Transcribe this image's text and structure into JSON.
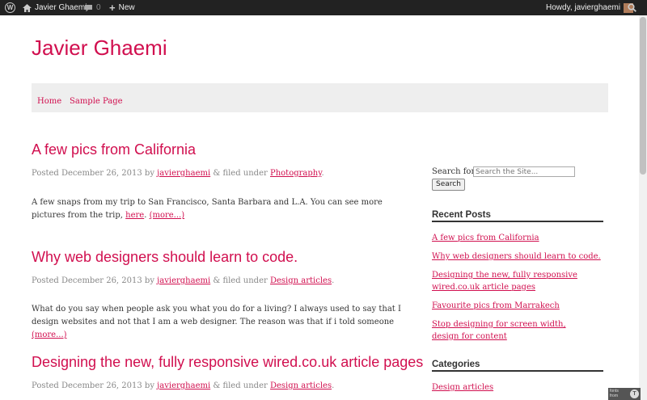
{
  "admin_bar": {
    "site_name": "Javier Ghaemi",
    "comments_count": "0",
    "new_label": "New",
    "greeting": "Howdy, javierghaemi"
  },
  "site": {
    "title": "Javier Ghaemi"
  },
  "nav": {
    "items": [
      "Home",
      "Sample Page"
    ]
  },
  "posts": [
    {
      "title": "A few pics from California",
      "meta_prefix": "Posted December 26, 2013 by",
      "author": "javierghaemi",
      "filed_text": "& filed under",
      "category": "Photography",
      "end": ".",
      "excerpt": "A few snaps from my trip to San Francisco, Santa Barbara and L.A. You can see more pictures from the trip,",
      "link_text": "here",
      "more": "(more...)"
    },
    {
      "title": "Why web designers should learn to code.",
      "meta_prefix": "Posted December 26, 2013 by",
      "author": "javierghaemi",
      "filed_text": "& filed under",
      "category": "Design articles",
      "end": ".",
      "excerpt": "What do you say when people ask you what you do for a living? I always used to say that I design websites and not that I am a web designer. The reason was that if i told someone",
      "more": "(more...)"
    },
    {
      "title": "Designing the new, fully responsive wired.co.uk article pages",
      "meta_prefix": "Posted December 26, 2013 by",
      "author": "javierghaemi",
      "filed_text": "& filed under",
      "category": "Design articles",
      "end": "."
    }
  ],
  "sidebar": {
    "search_label": "Search for:",
    "search_placeholder": "Search the Site...",
    "search_button": "Search",
    "recent_title": "Recent Posts",
    "recent_posts": [
      "A few pics from California",
      "Why web designers should learn to code.",
      "Designing the new, fully responsive wired.co.uk article pages",
      "Favourite pics from Marrakech",
      "Stop designing for screen width, design for content"
    ],
    "categories_title": "Categories",
    "categories": [
      "Design articles"
    ]
  },
  "badge": {
    "line1": "fonts",
    "line2": "from"
  },
  "icons": {
    "admin_bar": [
      "wordpress-logo-icon",
      "home-icon",
      "comment-icon",
      "plus-icon",
      "avatar-icon",
      "search-icon"
    ]
  }
}
